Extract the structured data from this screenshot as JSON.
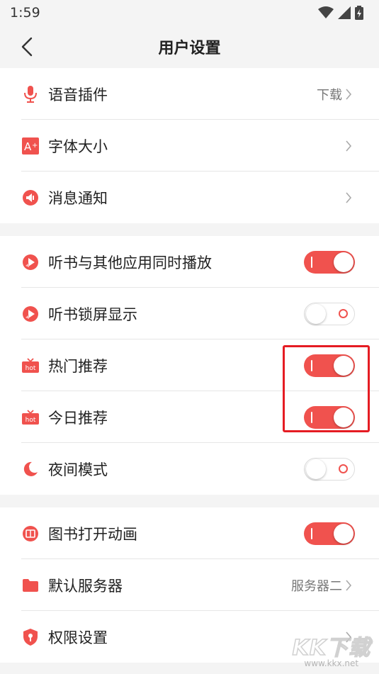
{
  "status": {
    "time": "1:59"
  },
  "header": {
    "title": "用户设置"
  },
  "group1": [
    {
      "label": "语音插件",
      "value": "下载",
      "icon": "microphone-icon"
    },
    {
      "label": "字体大小",
      "value": "",
      "icon": "font-size-icon"
    },
    {
      "label": "消息通知",
      "value": "",
      "icon": "notification-icon"
    }
  ],
  "group2": [
    {
      "label": "听书与其他应用同时播放",
      "on": true,
      "icon": "play-audio-icon"
    },
    {
      "label": "听书锁屏显示",
      "on": false,
      "icon": "lockscreen-play-icon"
    },
    {
      "label": "热门推荐",
      "on": true,
      "icon": "hot-badge-icon",
      "badge": "hot"
    },
    {
      "label": "今日推荐",
      "on": true,
      "icon": "hot-badge-icon",
      "badge": "hot"
    },
    {
      "label": "夜间模式",
      "on": false,
      "icon": "moon-icon"
    }
  ],
  "group3": [
    {
      "label": "图书打开动画",
      "on": true,
      "icon": "book-animation-icon"
    },
    {
      "label": "默认服务器",
      "value": "服务器二",
      "icon": "folder-icon"
    },
    {
      "label": "权限设置",
      "value": "",
      "icon": "shield-key-icon"
    }
  ],
  "watermark": {
    "big": "KK下载",
    "small": "www.kkx.net"
  },
  "colors": {
    "accent": "#f0524e",
    "highlight": "#e51c23",
    "background": "#f4f4f4"
  }
}
